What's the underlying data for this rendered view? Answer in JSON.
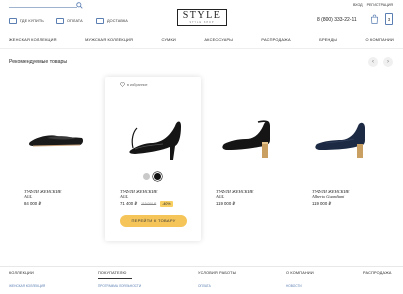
{
  "header": {
    "util": [
      {
        "label": "ГДЕ КУПИТЬ",
        "icon": "store-icon"
      },
      {
        "label": "ОПЛАТА",
        "icon": "payment-icon"
      },
      {
        "label": "ДОСТАВКА",
        "icon": "delivery-icon"
      }
    ],
    "logo": {
      "title": "STYLE",
      "tagline": "STYLE SHOP"
    },
    "links": {
      "login": "ВХОД",
      "register": "РЕГИСТРАЦИЯ"
    },
    "phone": "8 (800) 333-22-11",
    "cart_count": "3"
  },
  "nav": [
    "ЖЕНСКАЯ КОЛЛЕКЦИЯ",
    "МУЖСКАЯ КОЛЛЕКЦИЯ",
    "СУМКИ",
    "АКСЕССУАРЫ",
    "РАСПРОДАЖА",
    "БРЕНДЫ",
    "О КОМПАНИИ"
  ],
  "section": {
    "title": "Рекомендуемые товары",
    "prev": "‹",
    "next": "›"
  },
  "products": [
    {
      "name": "ТУФЛИ ЖЕНСКИЕ",
      "brand": "AGL",
      "price": "84 000 ₽"
    },
    {
      "name": "ТУФЛИ ЖЕНСКИЕ",
      "brand": "AGL",
      "price": "71 400 ₽",
      "old_price": "119 000 ₽",
      "discount": "-40%",
      "favorite_label": "в избранное",
      "cta": "ПЕРЕЙТИ К ТОВАРУ"
    },
    {
      "name": "ТУФЛИ ЖЕНСКИЕ",
      "brand": "AGL",
      "price": "119 000 ₽"
    },
    {
      "name": "ТУФЛИ ЖЕНСКИЕ",
      "brand": "Alberto Guardiani",
      "price": "119 000 ₽"
    }
  ],
  "colors": {
    "accent": "#f5c55a",
    "swatch_grey": "#c9c9c9",
    "swatch_black": "#111111",
    "link": "#5b7fb3"
  },
  "footer": {
    "columns": [
      {
        "heading": "КОЛЛЕКЦИИ",
        "item": "ЖЕНСКАЯ КОЛЛЕКЦИЯ"
      },
      {
        "heading": "ПОКУПАТЕЛЮ",
        "item": "ПРОГРАММА ЛОЯЛЬНОСТИ"
      },
      {
        "heading": "УСЛОВИЯ РАБОТЫ",
        "item": "ОПЛАТА"
      },
      {
        "heading": "О КОМПАНИИ",
        "item": "НОВОСТИ"
      },
      {
        "heading": "РАСПРОДАЖА",
        "item": ""
      }
    ]
  }
}
